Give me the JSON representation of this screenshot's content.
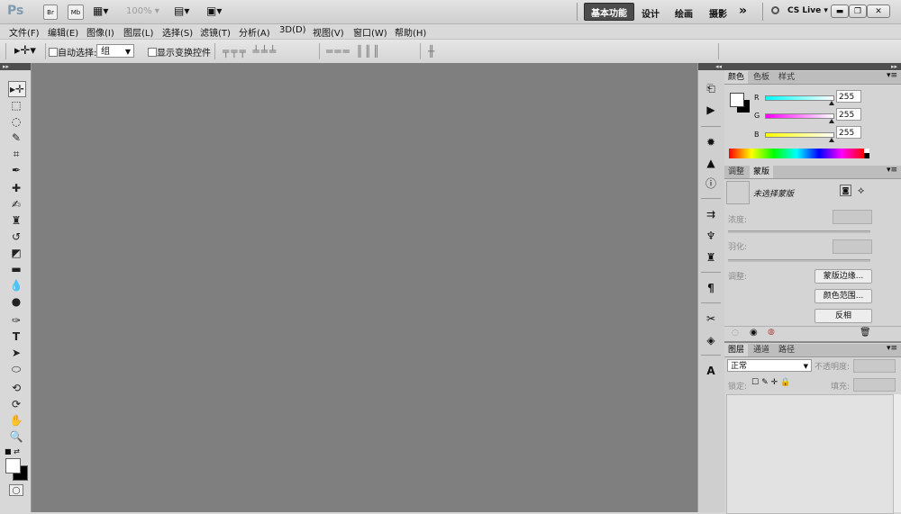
{
  "app": {
    "logo": "Ps",
    "br_label": "Br",
    "mb_label": "Mb",
    "zoom": "100%",
    "workspaces": [
      "基本功能",
      "设计",
      "绘画",
      "摄影"
    ],
    "more": "»",
    "cs_live": "CS Live"
  },
  "menu": [
    "文件(F)",
    "编辑(E)",
    "图像(I)",
    "图层(L)",
    "选择(S)",
    "滤镜(T)",
    "分析(A)",
    "3D(D)",
    "视图(V)",
    "窗口(W)",
    "帮助(H)"
  ],
  "options": {
    "auto_select_label": "自动选择:",
    "auto_select_value": "组",
    "show_transform_label": "显示变换控件"
  },
  "color_panel": {
    "tabs": [
      "颜色",
      "色板",
      "样式"
    ],
    "r_label": "R",
    "g_label": "G",
    "b_label": "B",
    "r_value": "255",
    "g_value": "255",
    "b_value": "255"
  },
  "masks_panel": {
    "tabs": [
      "调整",
      "蒙版"
    ],
    "no_mask": "未选择蒙版",
    "density_label": "浓度:",
    "feather_label": "羽化:",
    "refine_label": "调整:",
    "mask_edge": "蒙版边缘...",
    "color_range": "颜色范围...",
    "invert": "反相"
  },
  "layers_panel": {
    "tabs": [
      "图层",
      "通道",
      "路径"
    ],
    "blend_mode": "正常",
    "opacity_label": "不透明度:",
    "lock_label": "锁定:",
    "fill_label": "填充:"
  },
  "colors": {
    "canvas": "#7f7f7f",
    "active_workspace": "#4c4c4c"
  }
}
